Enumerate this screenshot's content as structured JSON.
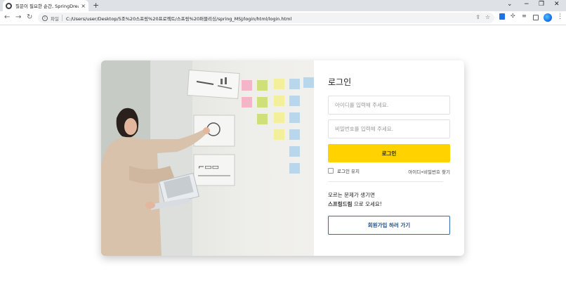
{
  "browser": {
    "tab_title": "질문이 필요한 순간, SpringDrea",
    "tab_close": "×",
    "new_tab": "+",
    "win_min": "⌄",
    "win_minimize": "−",
    "win_restore": "❐",
    "win_close": "✕",
    "nav_back": "←",
    "nav_forward": "→",
    "nav_reload": "↻",
    "url_scheme_label": "파일",
    "url": "C:/Users/user/Desktop/5조%20스프링%20프로젝트/스프링%20퍼블리싱/spring_MSJ/login/html/login.html"
  },
  "icons": {
    "tab_favicon": "globe-icon",
    "info": "info-icon",
    "share": "share-icon",
    "bookmark": "star-icon",
    "download": "download-icon",
    "extensions": "puzzle-icon",
    "media": "media-control-icon",
    "sidepanel": "side-panel-icon",
    "profile": "profile-avatar-icon",
    "menu": "kebab-menu-icon"
  },
  "login": {
    "title": "로그인",
    "id_placeholder": "아이디를 입력해 주세요.",
    "pw_placeholder": "비밀번호를 입력해 주세요.",
    "login_button": "로그인",
    "keep_login": "로그인 유지",
    "find_account": "아이디•비밀번호 찾기",
    "help_line1": "모르는 문제가 생기면",
    "help_brand": "스프링드림",
    "help_line2_rest": " 으로 오세요!",
    "signup_button": "회원가입 하러 가기"
  },
  "colors": {
    "accent": "#ffd200",
    "signup_border": "#2f6cb3",
    "signup_text": "#1f4e8c"
  }
}
